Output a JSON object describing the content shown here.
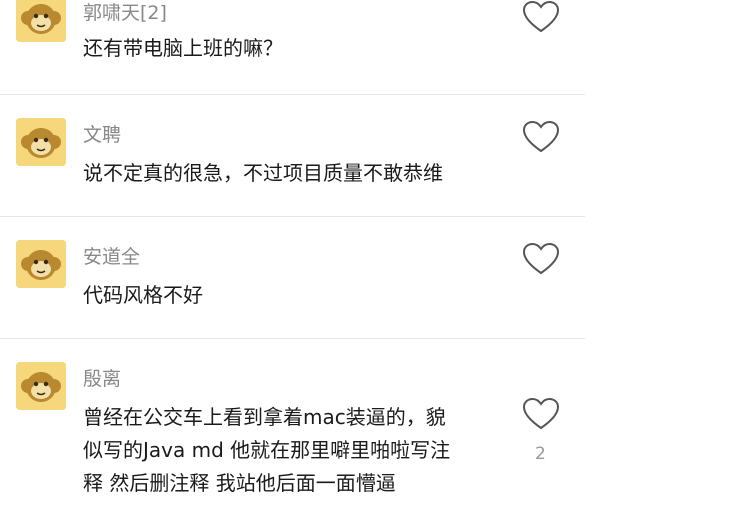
{
  "comments": [
    {
      "username": "郭啸天[2]",
      "content": "还有带电脑上班的嘛？",
      "like_count": ""
    },
    {
      "username": "文聘",
      "content": "说不定真的很急，不过项目质量不敢恭维",
      "like_count": ""
    },
    {
      "username": "安道全",
      "content": "代码风格不好",
      "like_count": ""
    },
    {
      "username": "殷离",
      "content": "曾经在公交车上看到拿着mac装逼的，貌\n似写的Java md 他就在那里噼里啪啦写注\n释 然后删注释 我站他后面一面懵逼",
      "like_count": "2"
    }
  ],
  "icons": {
    "avatar": "monkey-avatar-icon",
    "like": "heart-outline-icon"
  },
  "colors": {
    "username": "#888888",
    "content": "#1a1a1a",
    "avatar_bg": "#f6d77b",
    "divider": "#e6e6e6",
    "like_stroke": "#555555"
  }
}
